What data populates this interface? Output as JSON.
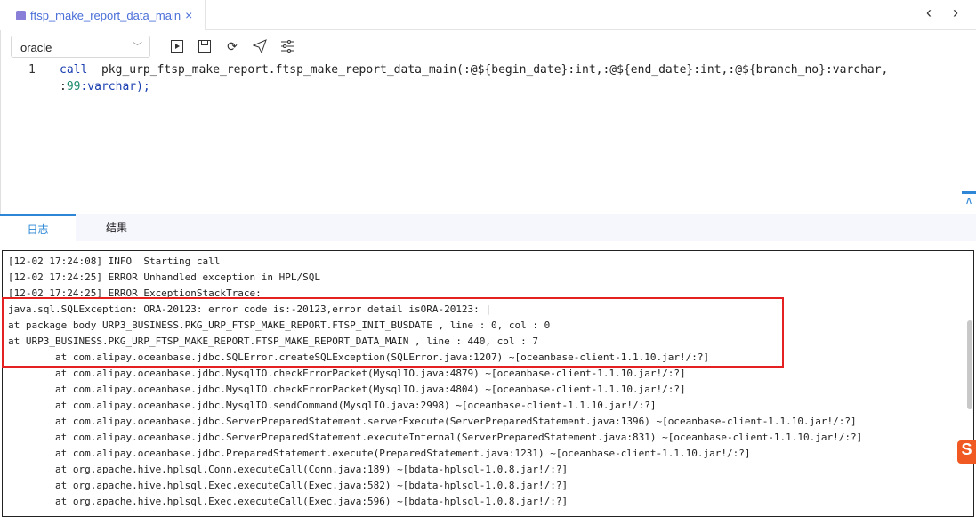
{
  "file_tab": {
    "title": "ftsp_make_report_data_main",
    "close": "×"
  },
  "nav": {
    "back": "‹",
    "forward": "›"
  },
  "toolbar": {
    "dialect": "oracle",
    "buttons": [
      "run",
      "save",
      "refresh",
      "publish",
      "format"
    ]
  },
  "editor": {
    "line_number": "1",
    "line1_kw": "call",
    "line1_rest": "  pkg_urp_ftsp_make_report.ftsp_make_report_data_main(:@${begin_date}:int,:@${end_date}:int,:@${branch_no}:varchar,",
    "line2_colon": ":",
    "line2_num": "99",
    "line2_rest": ":varchar);"
  },
  "panel_tabs": [
    {
      "label": "日志",
      "active": true
    },
    {
      "label": "结果",
      "active": false
    }
  ],
  "log_lines": [
    "[12-02 17:24:08] INFO  Starting call",
    "[12-02 17:24:25] ERROR Unhandled exception in HPL/SQL",
    "[12-02 17:24:25] ERROR ExceptionStackTrace:",
    "java.sql.SQLException: ORA-20123: error code is:-20123,error detail isORA-20123: |",
    "at package body URP3_BUSINESS.PKG_URP_FTSP_MAKE_REPORT.FTSP_INIT_BUSDATE , line : 0, col : 0",
    "at URP3_BUSINESS.PKG_URP_FTSP_MAKE_REPORT.FTSP_MAKE_REPORT_DATA_MAIN , line : 440, col : 7",
    "        at com.alipay.oceanbase.jdbc.SQLError.createSQLException(SQLError.java:1207) ~[oceanbase-client-1.1.10.jar!/:?]",
    "        at com.alipay.oceanbase.jdbc.MysqlIO.checkErrorPacket(MysqlIO.java:4879) ~[oceanbase-client-1.1.10.jar!/:?]",
    "        at com.alipay.oceanbase.jdbc.MysqlIO.checkErrorPacket(MysqlIO.java:4804) ~[oceanbase-client-1.1.10.jar!/:?]",
    "        at com.alipay.oceanbase.jdbc.MysqlIO.sendCommand(MysqlIO.java:2998) ~[oceanbase-client-1.1.10.jar!/:?]",
    "        at com.alipay.oceanbase.jdbc.ServerPreparedStatement.serverExecute(ServerPreparedStatement.java:1396) ~[oceanbase-client-1.1.10.jar!/:?]",
    "        at com.alipay.oceanbase.jdbc.ServerPreparedStatement.executeInternal(ServerPreparedStatement.java:831) ~[oceanbase-client-1.1.10.jar!/:?]",
    "        at com.alipay.oceanbase.jdbc.PreparedStatement.execute(PreparedStatement.java:1231) ~[oceanbase-client-1.1.10.jar!/:?]",
    "        at org.apache.hive.hplsql.Conn.executeCall(Conn.java:189) ~[bdata-hplsql-1.0.8.jar!/:?]",
    "        at org.apache.hive.hplsql.Exec.executeCall(Exec.java:582) ~[bdata-hplsql-1.0.8.jar!/:?]",
    "        at org.apache.hive.hplsql.Exec.executeCall(Exec.java:596) ~[bdata-hplsql-1.0.8.jar!/:?]"
  ],
  "colors": {
    "accent": "#2d87d6",
    "highlight": "#e52020",
    "keyword": "#1a3fb0"
  }
}
